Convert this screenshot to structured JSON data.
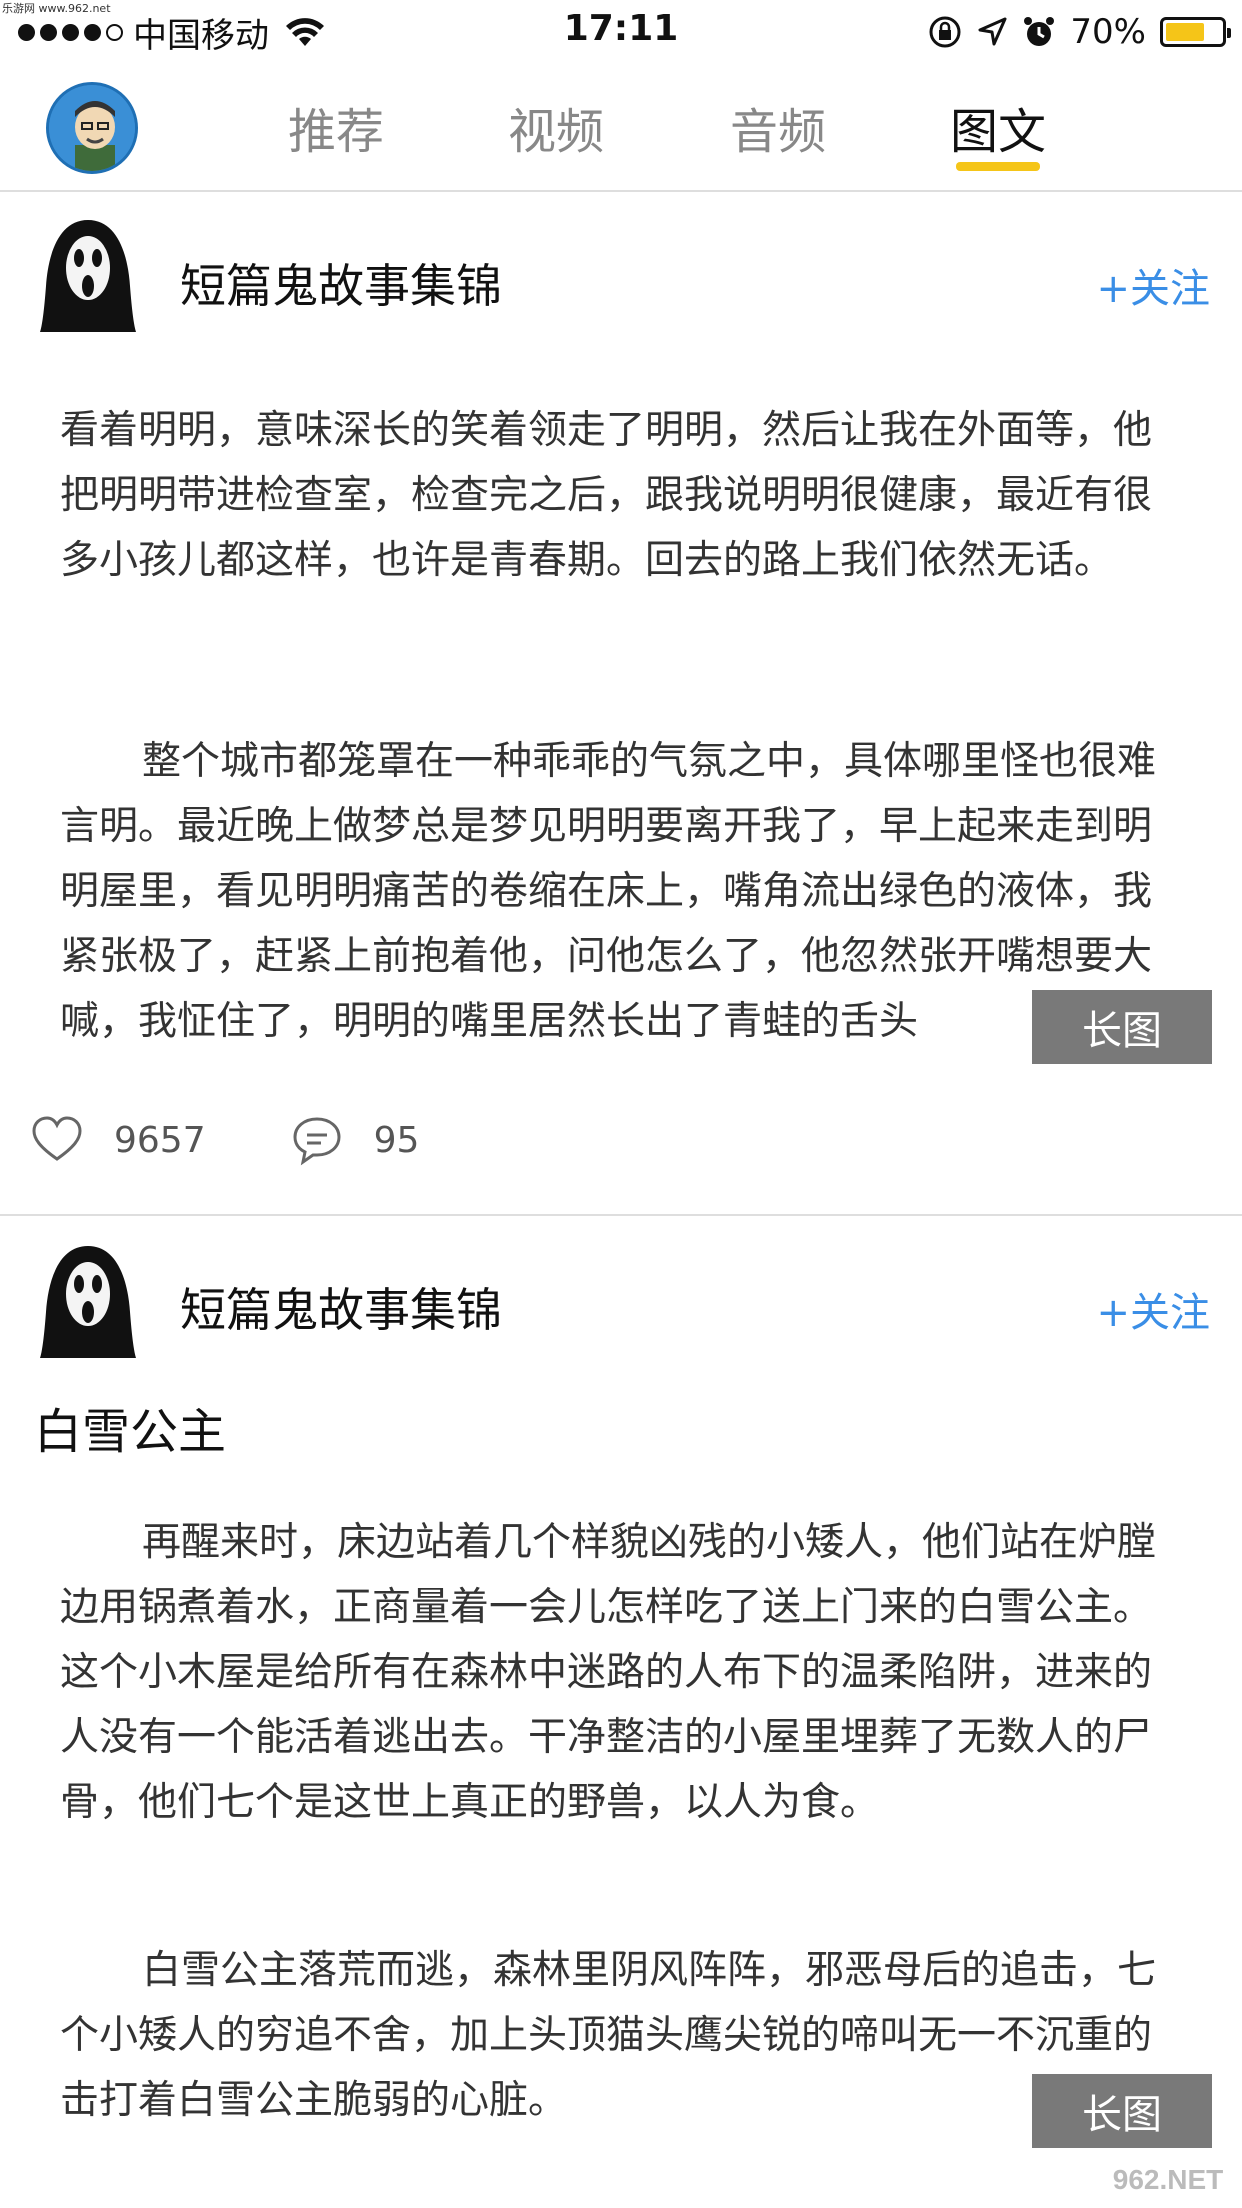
{
  "watermark_top": "乐游网 www.962.net",
  "statusbar": {
    "carrier": "中国移动",
    "time": "17:11",
    "battery": "70%",
    "battery_level": 0.7
  },
  "nav": {
    "tabs": [
      {
        "label": "推荐",
        "active": false
      },
      {
        "label": "视频",
        "active": false
      },
      {
        "label": "音频",
        "active": false
      },
      {
        "label": "图文",
        "active": true
      }
    ]
  },
  "posts": [
    {
      "author": "短篇鬼故事集锦",
      "follow_label": "+关注",
      "paragraphs": [
        "看着明明，意味深长的笑着领走了明明，然后让我在外面等，他把明明带进检查室，检查完之后，跟我说明明很健康，最近有很多小孩儿都这样，也许是青春期。回去的路上我们依然无话。",
        "整个城市都笼罩在一种乖乖的气氛之中，具体哪里怪也很难言明。最近晚上做梦总是梦见明明要离开我了，早上起来走到明明屋里，看见明明痛苦的卷缩在床上，嘴角流出绿色的液体，我紧张极了，赶紧上前抱着他，问他怎么了，他忽然张开嘴想要大喊，我怔住了，明明的嘴里居然长出了青蛙的舌头"
      ],
      "long_image_label": "长图",
      "likes": "9657",
      "comments": "95"
    },
    {
      "author": "短篇鬼故事集锦",
      "follow_label": "+关注",
      "title": "白雪公主",
      "paragraphs": [
        "再醒来时，床边站着几个样貌凶残的小矮人，他们站在炉膛边用锅煮着水，正商量着一会儿怎样吃了送上门来的白雪公主。这个小木屋是给所有在森林中迷路的人布下的温柔陷阱，进来的人没有一个能活着逃出去。干净整洁的小屋里埋葬了无数人的尸骨，他们七个是这世上真正的野兽，以人为食。",
        "白雪公主落荒而逃，森林里阴风阵阵，邪恶母后的追击，七个小矮人的穷追不舍，加上头顶猫头鹰尖锐的啼叫无一不沉重的击打着白雪公主脆弱的心脏。"
      ],
      "long_image_label": "长图"
    }
  ],
  "watermark_bottom": "962.NET",
  "colors": {
    "accent": "#f5c518",
    "follow": "#3a8ee6"
  }
}
